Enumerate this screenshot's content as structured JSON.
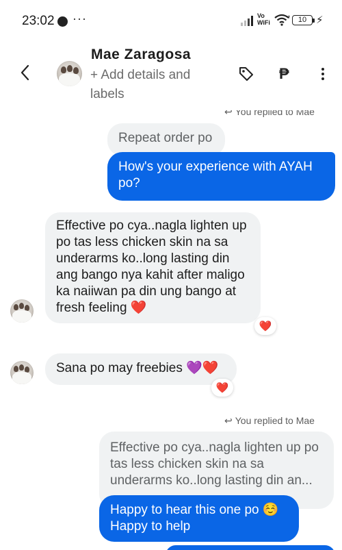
{
  "status_bar": {
    "time": "23:02",
    "more": "···",
    "vowifi": "Vo WiFi",
    "battery": "10",
    "icons": [
      "signal-icon",
      "wifi-icon",
      "battery-icon",
      "charging-icon"
    ]
  },
  "header": {
    "contact_name": "Mae Zaragosa",
    "subtitle": "+ Add details and labels",
    "peso_symbol": "₱",
    "icons": [
      "back-arrow-icon",
      "tag-icon",
      "peso-icon",
      "more-vertical-icon"
    ]
  },
  "messages": {
    "replied_top": "You replied to Mae",
    "quoted_1": "Repeat order po",
    "sent_1": "How's your experience with AYAH po?",
    "received_1": "Effective po cya..nagla lighten up po tas less chicken skin na sa underarms ko..long lasting din ang bango nya kahit after maligo ka naiiwan pa din ung bango at fresh feeling",
    "received_1_emoji": "❤️",
    "received_1_reaction": "❤️",
    "received_2": "Sana po may freebies",
    "received_2_emoji": "💜❤️",
    "received_2_reaction": "❤️",
    "replied_bottom": "You replied to Mae",
    "quoted_2": "Effective po cya..nagla lighten up po tas less chicken skin na sa underarms ko..long lasting din an...",
    "sent_2_line1": "Happy to hear this one po ☺️",
    "sent_2_line2": "Happy to help"
  },
  "colors": {
    "sent_bubble": "#0a66e6",
    "received_bubble": "#f0f2f3",
    "reaction_heart": "#e0243a"
  }
}
